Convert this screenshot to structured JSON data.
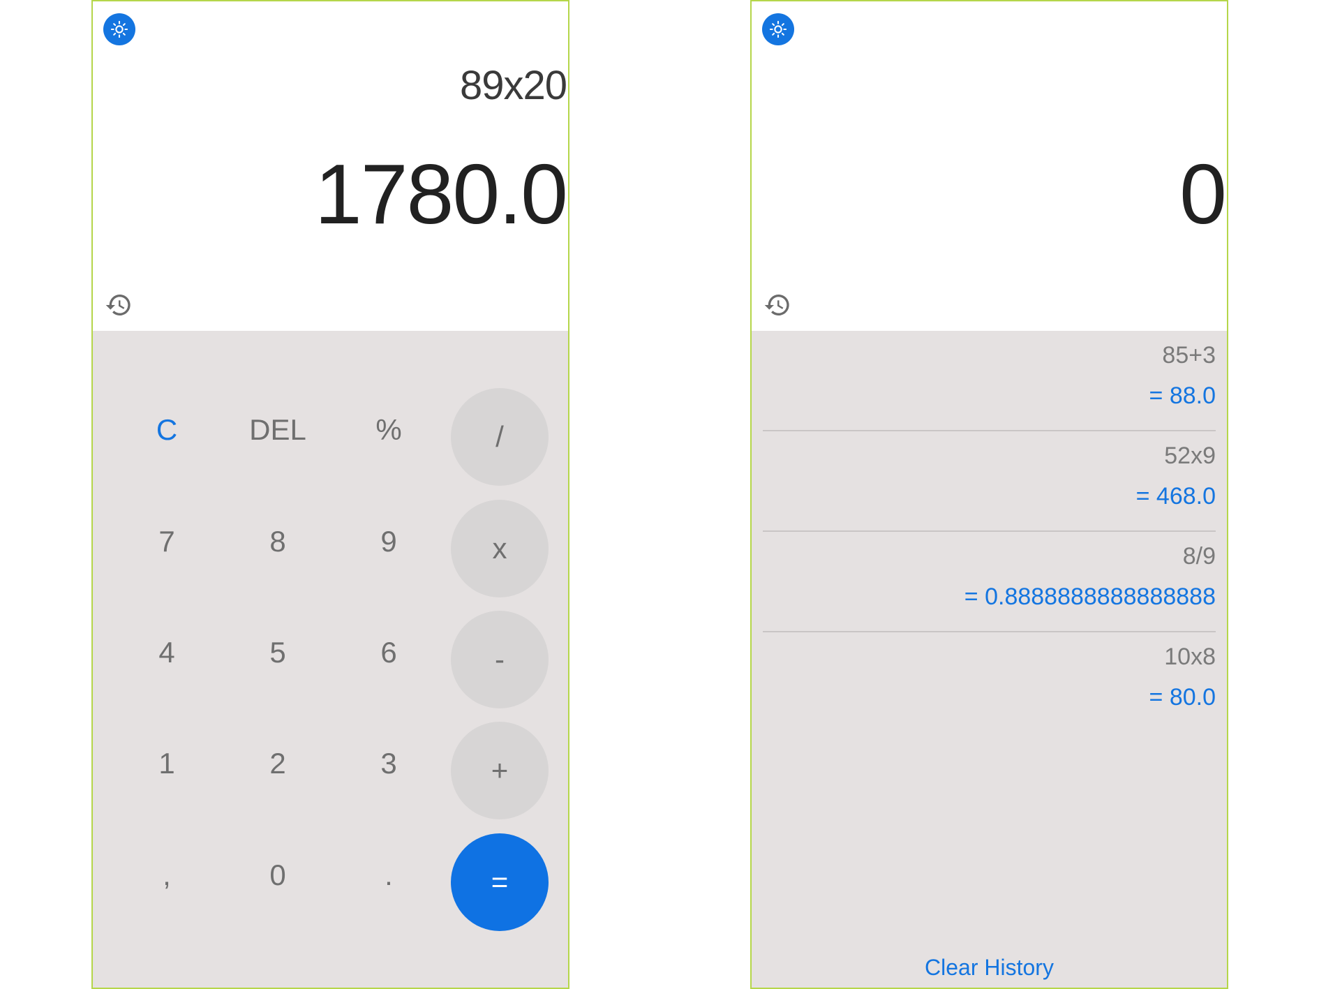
{
  "colors": {
    "accent": "#1475e0",
    "keypad_bg": "#e5e1e1",
    "operator_bg": "#d7d5d5",
    "frame_border": "#b5d64a"
  },
  "left_screen": {
    "theme_icon": "brightness-icon",
    "expression": "89x20",
    "result": "1780.0",
    "history_icon": "history-icon",
    "keys": {
      "clear": "C",
      "delete": "DEL",
      "percent": "%",
      "divide": "/",
      "seven": "7",
      "eight": "8",
      "nine": "9",
      "multiply": "x",
      "four": "4",
      "five": "5",
      "six": "6",
      "subtract": "-",
      "one": "1",
      "two": "2",
      "three": "3",
      "add": "+",
      "comma": ",",
      "zero": "0",
      "dot": ".",
      "equals": "="
    }
  },
  "right_screen": {
    "theme_icon": "brightness-icon",
    "result": "0",
    "history_icon": "history-icon",
    "history": [
      {
        "expression": "85+3",
        "result": "= 88.0"
      },
      {
        "expression": "52x9",
        "result": "= 468.0"
      },
      {
        "expression": "8/9",
        "result": "= 0.8888888888888888"
      },
      {
        "expression": "10x8",
        "result": "= 80.0"
      }
    ],
    "clear_history_label": "Clear History"
  }
}
